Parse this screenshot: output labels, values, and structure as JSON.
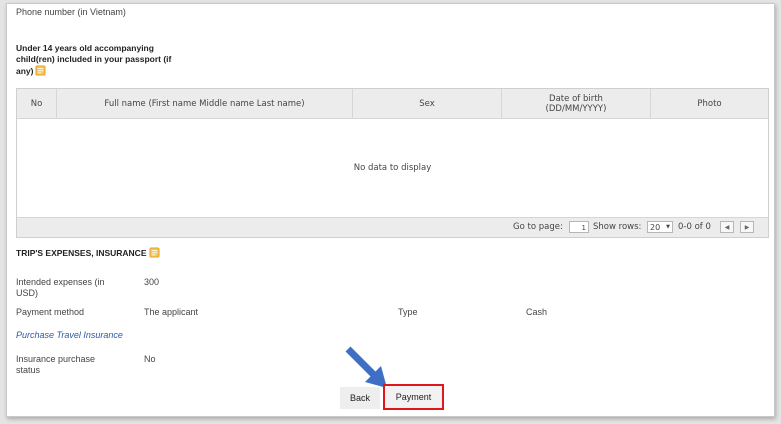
{
  "form": {
    "phone_label": "Phone number (in Vietnam)",
    "children_label": "Under 14 years old accompanying child(ren) included in your passport (if any)"
  },
  "children_table": {
    "columns": [
      "No",
      "Full name (First name Middle name Last name)",
      "Sex",
      "Date of birth (DD/MM/YYYY)",
      "Photo"
    ],
    "empty_text": "No data to display",
    "pager": {
      "goto_label": "Go to page:",
      "page_value": "1",
      "show_rows_label": "Show rows:",
      "rows_value": "20",
      "range_text": "0-0 of 0",
      "prev_icon": "◀",
      "next_icon": "▶",
      "select_arrow": "▼"
    }
  },
  "expenses": {
    "section_title": "TRIP'S EXPENSES, INSURANCE",
    "intended_label": "Intended expenses (in USD)",
    "intended_value": "300",
    "payment_method_label": "Payment method",
    "payment_method_value": "The applicant",
    "type_label": "Type",
    "type_value": "Cash",
    "purchase_link": "Purchase Travel Insurance",
    "insurance_status_label": "Insurance purchase status",
    "insurance_status_value": "No"
  },
  "actions": {
    "back_label": "Back",
    "payment_label": "Payment"
  },
  "colors": {
    "highlight": "#e0181e",
    "arrow": "#3f6fc4",
    "note_icon": "#f0b429"
  }
}
